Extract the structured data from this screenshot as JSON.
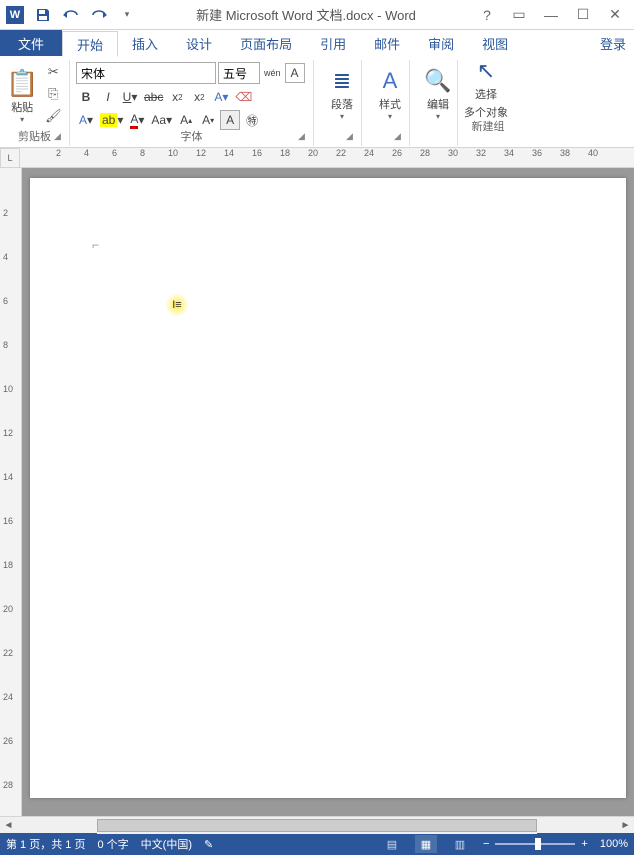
{
  "title": "新建 Microsoft Word 文档.docx - Word",
  "tabs": {
    "file": "文件",
    "items": [
      "开始",
      "插入",
      "设计",
      "页面布局",
      "引用",
      "邮件",
      "审阅",
      "视图"
    ],
    "active_index": 0,
    "login": "登录"
  },
  "ribbon": {
    "clipboard": {
      "paste": "粘贴",
      "label": "剪贴板"
    },
    "font": {
      "name": "宋体",
      "size": "五号",
      "wen": "wén",
      "label": "字体",
      "buttons": {
        "bold": "B",
        "italic": "I",
        "underline": "U",
        "abc": "abc"
      }
    },
    "paragraph": {
      "label": "段落"
    },
    "styles": {
      "label": "样式"
    },
    "editing": {
      "label": "编辑"
    },
    "select_multi": {
      "line1": "选择",
      "line2": "多个对象",
      "group": "新建组"
    }
  },
  "ruler_h": [
    2,
    4,
    6,
    8,
    10,
    12,
    14,
    16,
    18,
    20,
    22,
    24,
    26,
    28,
    30,
    32,
    34,
    36,
    38,
    40
  ],
  "ruler_v": [
    2,
    4,
    6,
    8,
    10,
    12,
    14,
    16,
    18,
    20,
    22,
    24,
    26,
    28
  ],
  "status": {
    "page": "第 1 页，共 1 页",
    "words": "0 个字",
    "lang": "中文(中国)",
    "zoom": "100%"
  }
}
